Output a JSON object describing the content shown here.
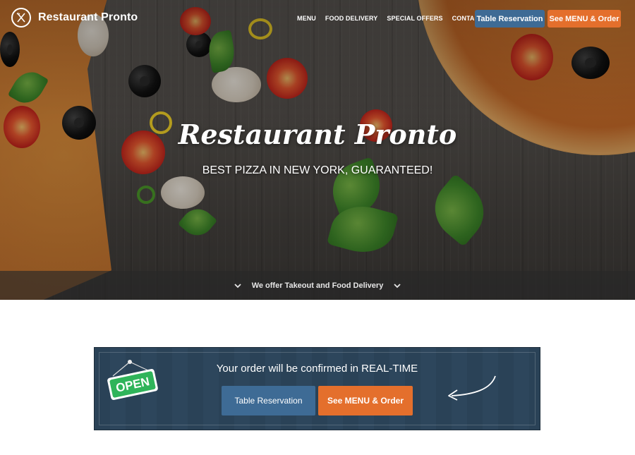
{
  "brand": {
    "name": "Restaurant Pronto",
    "logo_icon": "fork-knife-icon"
  },
  "nav": {
    "items": [
      "MENU",
      "FOOD DELIVERY",
      "SPECIAL OFFERS",
      "CONTACT US"
    ],
    "reserve_label": "Table Reservation",
    "order_label": "See MENU & Order"
  },
  "hero": {
    "title": "Restaurant Pronto",
    "subtitle": "BEST PIZZA IN NEW YORK, GUARANTEED!",
    "bar_text": "We offer Takeout and Food Delivery"
  },
  "cta": {
    "heading": "Your order will be confirmed in REAL-TIME",
    "sign_text": "OPEN",
    "reserve_label": "Table Reservation",
    "order_label": "See MENU & Order"
  },
  "colors": {
    "reserve": "#3e6b95",
    "order": "#e46f2c",
    "cta_bg": "#2a4257",
    "open_sign": "#2fb45a"
  }
}
